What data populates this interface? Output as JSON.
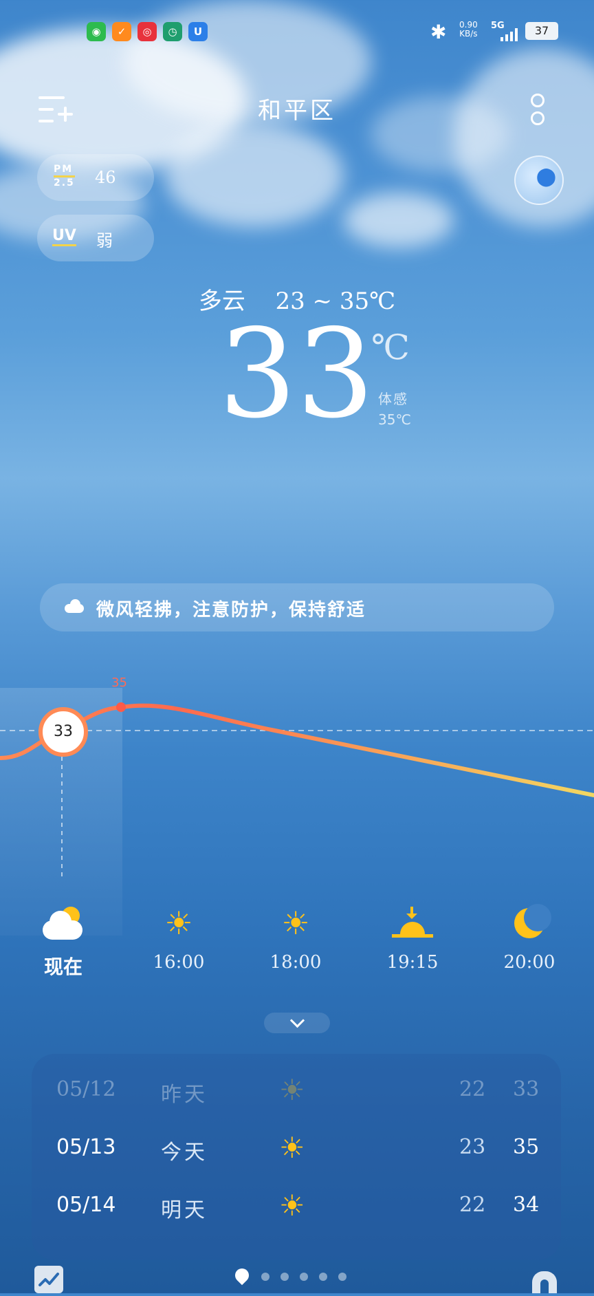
{
  "status": {
    "speed_value": "0.90",
    "speed_unit": "KB/s",
    "network": "5G",
    "battery": "37",
    "apps": [
      "wechat-icon",
      "taobao-icon",
      "netease-music-icon",
      "clock-app-icon",
      "shield-app-icon"
    ]
  },
  "header": {
    "location": "和平区"
  },
  "air": {
    "pm_label_top": "PM",
    "pm_label_bottom": "2.5",
    "pm_value": "46",
    "uv_label": "UV",
    "uv_value": "弱"
  },
  "current": {
    "condition": "多云",
    "range": "23 ~ 35℃",
    "temp": "33",
    "unit": "℃",
    "feels_label": "体感",
    "feels_value": "35℃"
  },
  "tip": {
    "text": "微风轻拂，注意防护，保持舒适"
  },
  "hourly": {
    "current_value": "33",
    "peak_value": "35",
    "items": [
      {
        "label": "现在",
        "icon": "partly-cloudy-icon"
      },
      {
        "label": "16:00",
        "icon": "sun-icon"
      },
      {
        "label": "18:00",
        "icon": "sun-icon"
      },
      {
        "label": "19:15",
        "icon": "sunset-icon"
      },
      {
        "label": "20:00",
        "icon": "moon-icon"
      }
    ]
  },
  "daily": [
    {
      "date": "05/12",
      "day": "昨天",
      "icon": "sun-icon",
      "low": "22",
      "high": "33"
    },
    {
      "date": "05/13",
      "day": "今天",
      "icon": "sun-icon",
      "low": "23",
      "high": "35"
    },
    {
      "date": "05/14",
      "day": "明天",
      "icon": "sun-icon",
      "low": "22",
      "high": "34"
    }
  ],
  "colors": {
    "curve_start": "#ff6a4d",
    "curve_end": "#f2d862",
    "sun": "#ffc21a"
  }
}
